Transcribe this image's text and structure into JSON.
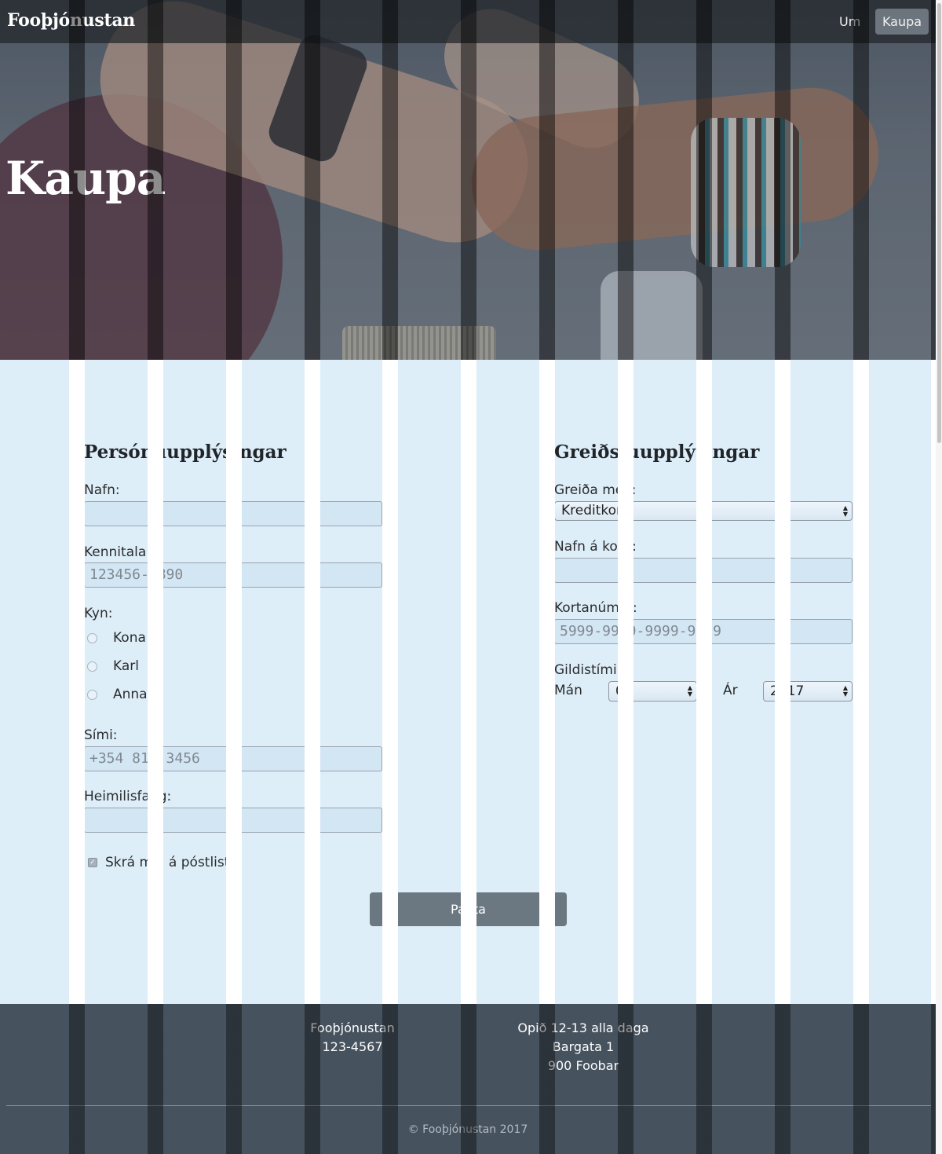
{
  "navbar": {
    "brand": "Fooþjónustan",
    "links": [
      {
        "label": "Um"
      },
      {
        "label": "Kaupa"
      }
    ]
  },
  "hero": {
    "title": "Kaupa"
  },
  "personal": {
    "title": "Persónuupplýsingar",
    "name_label": "Nafn:",
    "name_value": "",
    "kennitala_label": "Kennitala:",
    "kennitala_placeholder": "123456-7890",
    "gender_label": "Kyn:",
    "gender_options": [
      "Kona",
      "Karl",
      "Annað"
    ],
    "phone_label": "Sími:",
    "phone_placeholder": "+354 812 3456",
    "address_label": "Heimilisfang:",
    "address_value": "",
    "mailing_list_label": "Skrá mig á póstlista",
    "mailing_list_checked": true
  },
  "payment": {
    "title": "Greiðsluupplýsingar",
    "method_label": "Greiða með:",
    "method_value": "Kreditkorti",
    "card_name_label": "Nafn á korti:",
    "card_name_value": "",
    "card_number_label": "Kortanúmer:",
    "card_number_placeholder": "5999-9999-9999-9999",
    "expiry_label": "Gildistími:",
    "month_label": "Mán",
    "month_value": "01",
    "year_label": "Ár",
    "year_value": "2017"
  },
  "submit_label": "Panta",
  "footer": {
    "company": "Fooþjónustan",
    "phone": "123-4567",
    "hours": "Opið 12-13 alla daga",
    "street": "Bargata 1",
    "city": "900 Foobar",
    "copyright": "© Fooþjónustan 2017"
  },
  "colors": {
    "main_bg": "#ddeef9",
    "footer_bg": "#46525e",
    "button_bg": "#6b7781",
    "grid_gutter": "#ffffff",
    "grid_gutter_dark": "#000000"
  }
}
